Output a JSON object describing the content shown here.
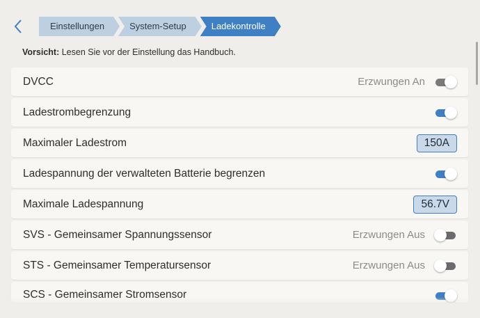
{
  "nav": {
    "back_icon": "chevron-left-icon",
    "breadcrumbs": [
      "Einstellungen",
      "System-Setup",
      "Ladekontrolle"
    ]
  },
  "warning": {
    "prefix": "Vorsicht:",
    "text": " Lesen Sie vor der Einstellung das Handbuch."
  },
  "settings": [
    {
      "label": "DVCC",
      "status": "Erzwungen An",
      "control": "toggle",
      "state": "forced-on"
    },
    {
      "label": "Ladestrombegrenzung",
      "status": "",
      "control": "toggle",
      "state": "on"
    },
    {
      "label": "Maximaler Ladestrom",
      "value": "150A",
      "control": "value"
    },
    {
      "label": "Ladespannung der verwalteten Batterie begrenzen",
      "status": "",
      "control": "toggle",
      "state": "on"
    },
    {
      "label": "Maximale Ladespannung",
      "value": "56.7V",
      "control": "value"
    },
    {
      "label": "SVS - Gemeinsamer Spannungssensor",
      "status": "Erzwungen Aus",
      "control": "toggle",
      "state": "off"
    },
    {
      "label": "STS - Gemeinsamer Temperatursensor",
      "status": "Erzwungen Aus",
      "control": "toggle",
      "state": "off"
    },
    {
      "label": "SCS - Gemeinsamer Stromsensor",
      "status": "",
      "control": "toggle",
      "state": "on"
    }
  ],
  "colors": {
    "accent": "#3f7fc4",
    "breadcrumb_inactive": "#bcd0e2",
    "background": "#efeeea",
    "row_background": "#f8f7f4"
  }
}
